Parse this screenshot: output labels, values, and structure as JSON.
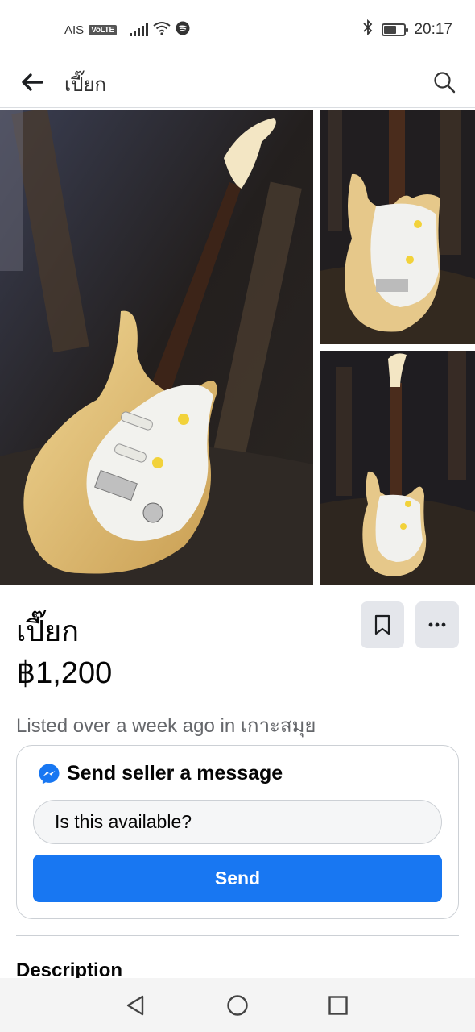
{
  "status_bar": {
    "carrier": "AIS",
    "volte": "VoLTE",
    "time": "20:17",
    "battery_level": 0.55
  },
  "nav": {
    "title": "เปี๊ยก",
    "back_icon": "arrow-left-icon",
    "search_icon": "search-icon"
  },
  "gallery": {
    "photos": [
      "guitar-photo-main",
      "guitar-photo-2",
      "guitar-photo-3"
    ]
  },
  "listing": {
    "title": "เปี๊ยก",
    "price": "฿1,200",
    "meta": "Listed over a week ago in เกาะสมุย"
  },
  "message_card": {
    "heading": "Send seller a message",
    "input_value": "Is this available?",
    "send_label": "Send"
  },
  "description": {
    "heading": "Description"
  },
  "colors": {
    "accent": "#1877f2",
    "button_bg": "#e4e6eb",
    "text_secondary": "#65676b"
  }
}
